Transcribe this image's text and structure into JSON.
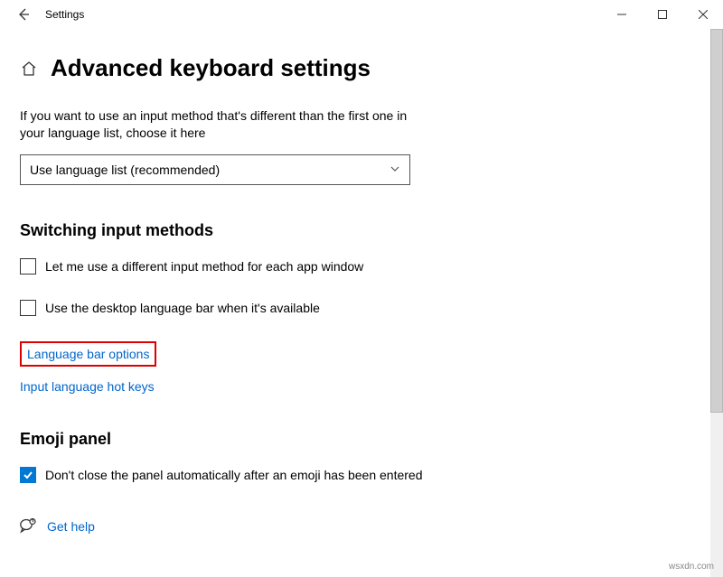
{
  "titlebar": {
    "app_name": "Settings"
  },
  "page": {
    "heading": "Advanced keyboard settings",
    "description": "If you want to use an input method that's different than the first one in your language list, choose it here",
    "select_value": "Use language list (recommended)"
  },
  "section_switching": {
    "heading": "Switching input methods",
    "check1_label": "Let me use a different input method for each app window",
    "check2_label": "Use the desktop language bar when it's available",
    "link_lang_bar": "Language bar options",
    "link_hotkeys": "Input language hot keys"
  },
  "section_emoji": {
    "heading": "Emoji panel",
    "check_label": "Don't close the panel automatically after an emoji has been entered"
  },
  "help": {
    "label": "Get help"
  },
  "watermark": "wsxdn.com"
}
